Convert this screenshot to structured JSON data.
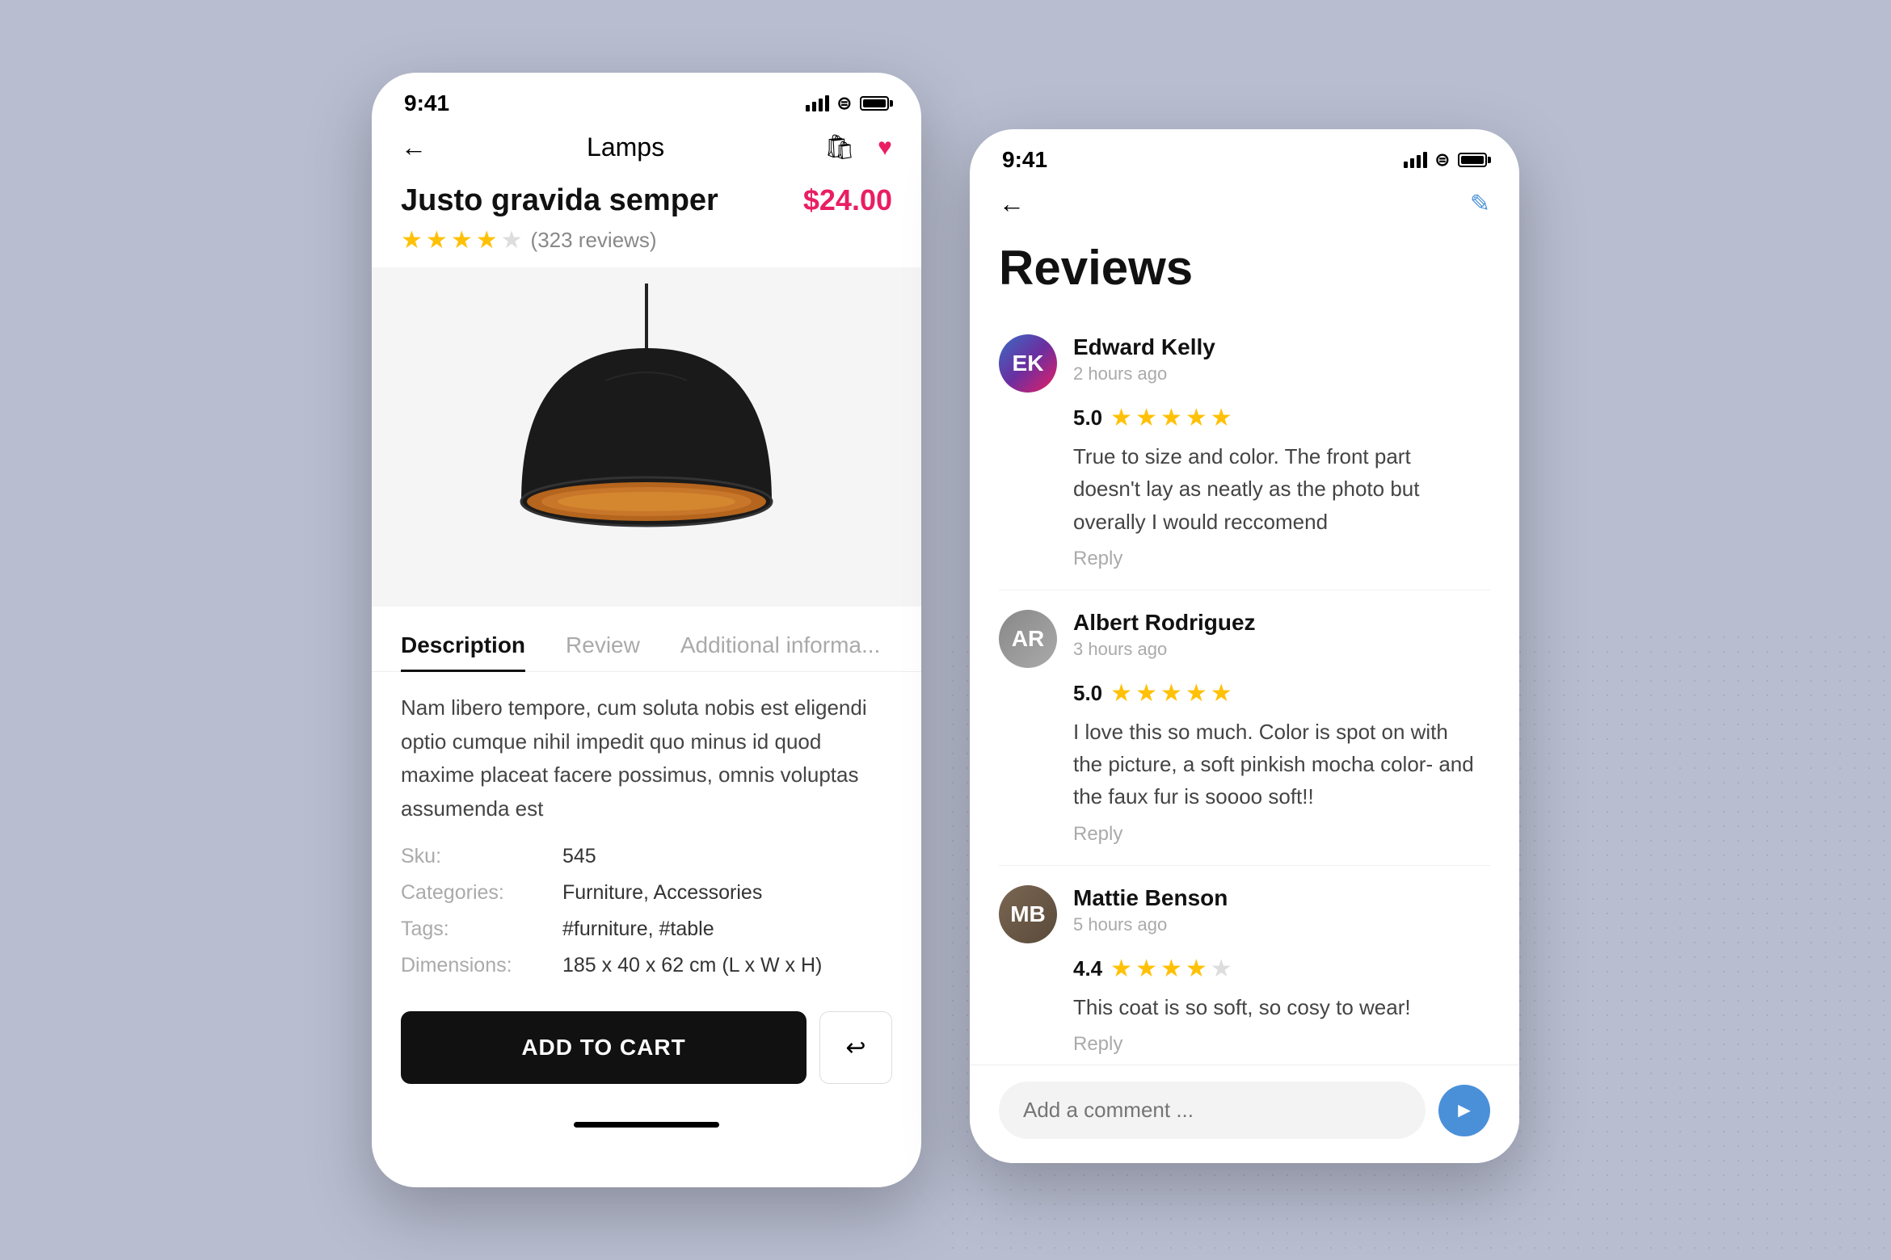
{
  "product_screen": {
    "status_time": "9:41",
    "nav_back_label": "←",
    "nav_title": "Lamps",
    "product_title": "Justo gravida semper",
    "product_price": "$24.00",
    "rating_value": 3.5,
    "review_count": "(323 reviews)",
    "stars": [
      {
        "filled": true
      },
      {
        "filled": true
      },
      {
        "filled": true
      },
      {
        "filled": true
      },
      {
        "filled": false
      }
    ],
    "tabs": [
      {
        "label": "Description",
        "active": true
      },
      {
        "label": "Review",
        "active": false
      },
      {
        "label": "Additional informa...",
        "active": false
      }
    ],
    "description": "Nam libero tempore, cum soluta nobis est eligendi optio cumque nihil impedit quo minus id quod maxime placeat facere possimus, omnis voluptas assumenda est",
    "details": [
      {
        "label": "Sku:",
        "value": "545"
      },
      {
        "label": "Categories:",
        "value": "Furniture, Accessories"
      },
      {
        "label": "Tags:",
        "value": "#furniture, #table"
      },
      {
        "label": "Dimensions:",
        "value": "185 x 40 x 62 cm (L x W x H)"
      }
    ],
    "add_to_cart_label": "ADD TO CART"
  },
  "reviews_screen": {
    "status_time": "9:41",
    "nav_back_label": "←",
    "title": "Reviews",
    "reviews": [
      {
        "id": "edward",
        "name": "Edward Kelly",
        "time": "2 hours ago",
        "score": "5.0",
        "stars": 5,
        "text": "True to size and color. The front part doesn't lay as neatly as the photo but overally I would reccomend",
        "reply_label": "Reply"
      },
      {
        "id": "albert",
        "name": "Albert Rodriguez",
        "time": "3 hours ago",
        "score": "5.0",
        "stars": 5,
        "text": "I love this so much. Color is spot on with the picture, a soft pinkish mocha color- and the faux fur is soooo soft!!",
        "reply_label": "Reply"
      },
      {
        "id": "mattie",
        "name": "Mattie Benson",
        "time": "5 hours ago",
        "score": "4.4",
        "stars": 4,
        "text": "This coat is so soft, so cosy to wear!",
        "reply_label": "Reply"
      }
    ],
    "comment_placeholder": "Add a comment ..."
  }
}
